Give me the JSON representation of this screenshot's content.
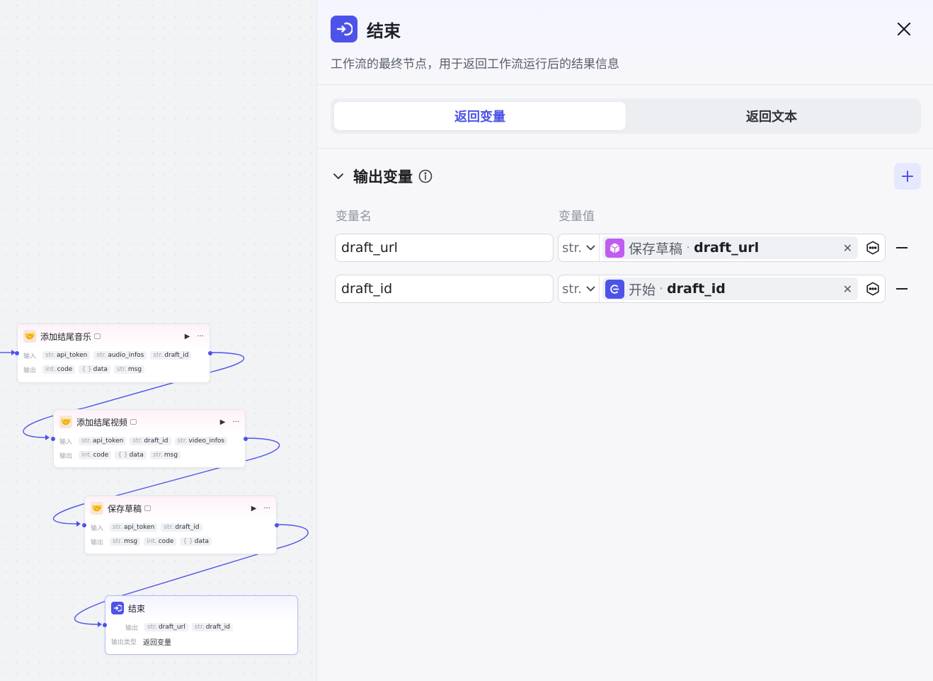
{
  "canvas": {
    "nodes": [
      {
        "title": "添加结尾音乐",
        "inputs_label": "输入",
        "outputs_label": "输出",
        "inputs": [
          {
            "type": "str.",
            "name": "api_token"
          },
          {
            "type": "str.",
            "name": "audio_infos"
          },
          {
            "type": "str.",
            "name": "draft_id"
          }
        ],
        "outputs": [
          {
            "type": "int.",
            "name": "code"
          },
          {
            "type": "{ }",
            "name": "data"
          },
          {
            "type": "str.",
            "name": "msg"
          }
        ]
      },
      {
        "title": "添加结尾视频",
        "inputs_label": "输入",
        "outputs_label": "输出",
        "inputs": [
          {
            "type": "str.",
            "name": "api_token"
          },
          {
            "type": "str.",
            "name": "draft_id"
          },
          {
            "type": "str.",
            "name": "video_infos"
          }
        ],
        "outputs": [
          {
            "type": "int.",
            "name": "code"
          },
          {
            "type": "{ }",
            "name": "data"
          },
          {
            "type": "str.",
            "name": "msg"
          }
        ]
      },
      {
        "title": "保存草稿",
        "inputs_label": "输入",
        "outputs_label": "输出",
        "inputs": [
          {
            "type": "str.",
            "name": "api_token"
          },
          {
            "type": "str.",
            "name": "draft_id"
          }
        ],
        "outputs": [
          {
            "type": "str.",
            "name": "msg"
          },
          {
            "type": "int.",
            "name": "code"
          },
          {
            "type": "{ }",
            "name": "data"
          }
        ]
      }
    ],
    "end_node": {
      "title": "结束",
      "outputs_label": "输出",
      "output_type_label": "输出类型",
      "output_type_value": "返回变量",
      "outputs": [
        {
          "type": "str.",
          "name": "draft_url"
        },
        {
          "type": "str.",
          "name": "draft_id"
        }
      ]
    },
    "icons": {
      "node_icon": "handshake-icon",
      "end_icon": "exit-icon"
    },
    "edge_color": "#4d53e8"
  },
  "panel": {
    "title": "结束",
    "description": "工作流的最终节点，用于返回工作流运行后的结果信息",
    "tabs": [
      {
        "label": "返回变量",
        "active": true
      },
      {
        "label": "返回文本",
        "active": false
      }
    ],
    "section_title": "输出变量",
    "col_name": "变量名",
    "col_value": "变量值",
    "variables": [
      {
        "name": "draft_url",
        "type": "str.",
        "ref_node": "保存草稿",
        "ref_var": "draft_url",
        "ref_icon": "cube-icon",
        "ref_icon_color": "#c05cf0"
      },
      {
        "name": "draft_id",
        "type": "str.",
        "ref_node": "开始",
        "ref_var": "draft_id",
        "ref_icon": "start-icon",
        "ref_icon_color": "#4d53e8"
      }
    ],
    "accent": "#4d53e8"
  }
}
